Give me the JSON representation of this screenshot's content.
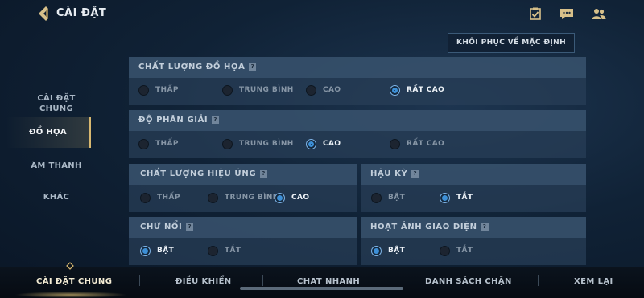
{
  "header": {
    "title": "CÀI ĐẶT",
    "icons": [
      "back-arrow-icon",
      "checklist-icon",
      "chat-icon",
      "friends-icon"
    ]
  },
  "reset_button": "KHÔI PHỤC VỀ MẶC ĐỊNH",
  "sidebar": {
    "items": [
      {
        "label": "CÀI ĐẶT CHUNG",
        "active": false
      },
      {
        "label": "ĐỒ HỌA",
        "active": true
      },
      {
        "label": "ÂM THANH",
        "active": false
      },
      {
        "label": "KHÁC",
        "active": false
      }
    ]
  },
  "sections": {
    "graphics_quality": {
      "title": "CHẤT LƯỢNG ĐỒ HỌA",
      "options": [
        "THẤP",
        "TRUNG BÌNH",
        "CAO",
        "RẤT CAO"
      ],
      "selected": "RẤT CAO"
    },
    "resolution": {
      "title": "ĐỘ PHÂN GIẢI",
      "options": [
        "THẤP",
        "TRUNG BÌNH",
        "CAO",
        "RẤT CAO"
      ],
      "selected": "CAO"
    },
    "effects_quality": {
      "title": "CHẤT LƯỢNG HIỆU ỨNG",
      "options": [
        "THẤP",
        "TRUNG BÌNH",
        "CAO"
      ],
      "selected": "CAO"
    },
    "post_processing": {
      "title": "HẬU KỲ",
      "options": [
        "BẬT",
        "TẮT"
      ],
      "selected": "TẮT"
    },
    "floating_text": {
      "title": "CHỮ NỔI",
      "options": [
        "BẬT",
        "TẮT"
      ],
      "selected": "BẬT"
    },
    "ui_animation": {
      "title": "HOẠT ẢNH GIAO DIỆN",
      "options": [
        "BẬT",
        "TẮT"
      ],
      "selected": "BẬT"
    }
  },
  "help_glyph": "?",
  "bottom_tabs": [
    {
      "label": "CÀI ĐẶT CHUNG",
      "active": true
    },
    {
      "label": "ĐIỀU KHIỂN",
      "active": false
    },
    {
      "label": "CHAT NHANH",
      "active": false
    },
    {
      "label": "DANH SÁCH CHẶN",
      "active": false
    },
    {
      "label": "XEM LẠI",
      "active": false
    }
  ],
  "colors": {
    "accent_gold": "#d8b870",
    "selected_blue": "#3d8fd6",
    "panel": "#2a3e58"
  }
}
